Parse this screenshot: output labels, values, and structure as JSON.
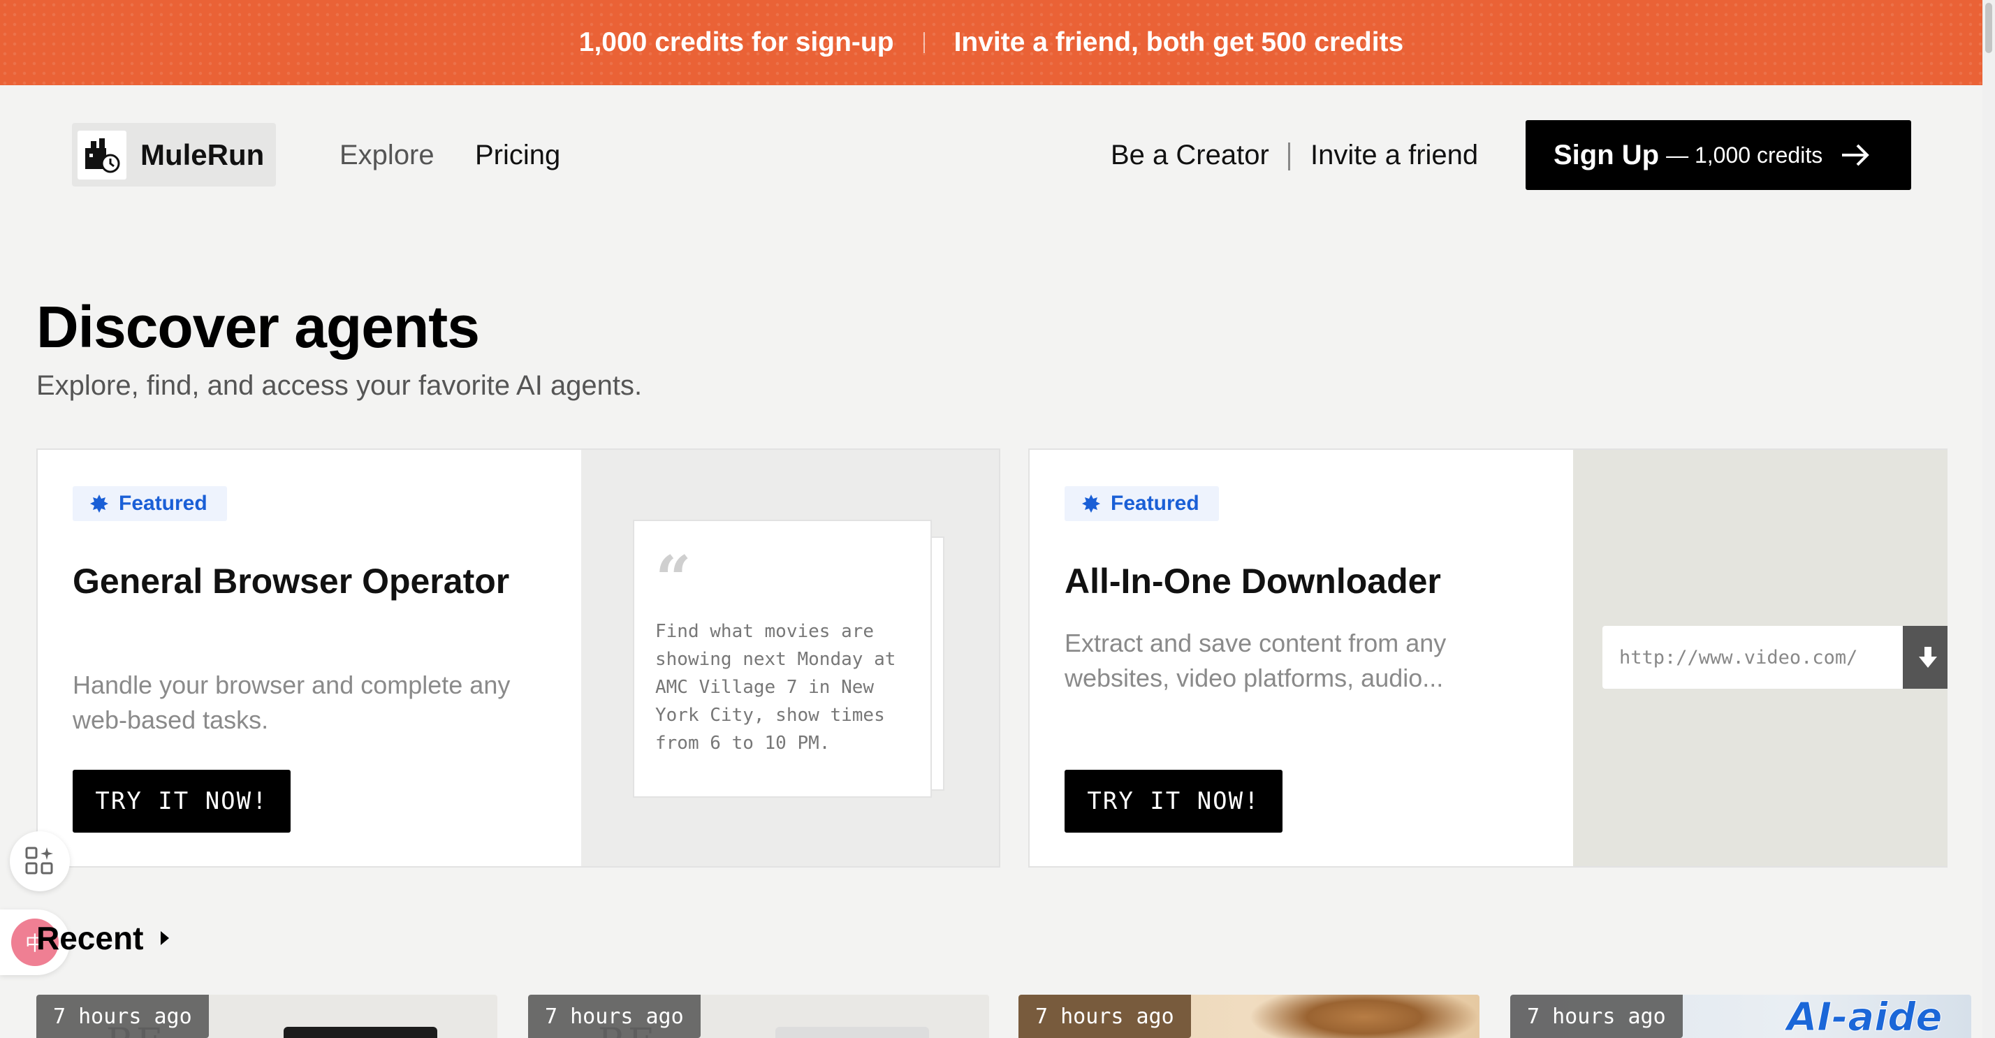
{
  "banner": {
    "signup_offer": "1,000 credits for sign-up",
    "invite_offer": "Invite a friend, both get 500 credits"
  },
  "header": {
    "logo_text": "MuleRun",
    "nav": {
      "explore": "Explore",
      "pricing": "Pricing",
      "creator": "Be a Creator",
      "invite": "Invite a friend"
    },
    "signup": {
      "label": "Sign Up",
      "credits": "— 1,000 credits",
      "icon": "arrow-right-icon"
    }
  },
  "hero": {
    "title": "Discover agents",
    "subtitle": "Explore, find, and access your favorite AI agents."
  },
  "featured": [
    {
      "badge": "Featured",
      "title": "General Browser Operator",
      "description": "Handle your browser and complete any web-based tasks.",
      "cta": "TRY IT NOW!",
      "quote_mark": "“",
      "example_prompt": "Find what movies are showing next Monday at AMC Village 7 in New York City, show times from 6 to 10 PM."
    },
    {
      "badge": "Featured",
      "title": "All-In-One Downloader",
      "description": "Extract and save content from any websites, video platforms, audio...",
      "cta": "TRY IT NOW!",
      "url_placeholder": "http://www.video.com/"
    }
  ],
  "floating": {
    "lang_glyph": "中"
  },
  "recent": {
    "title": "Recent",
    "items": [
      {
        "time": "7 hours ago",
        "deco_text": "RE"
      },
      {
        "time": "7 hours ago",
        "deco_text": "RE"
      },
      {
        "time": "7 hours ago"
      },
      {
        "time": "7 hours ago",
        "deco_text": "AI-aide"
      }
    ]
  },
  "colors": {
    "banner": "#ea6236",
    "featured_badge": "#1a5fd6",
    "button": "#000000"
  }
}
